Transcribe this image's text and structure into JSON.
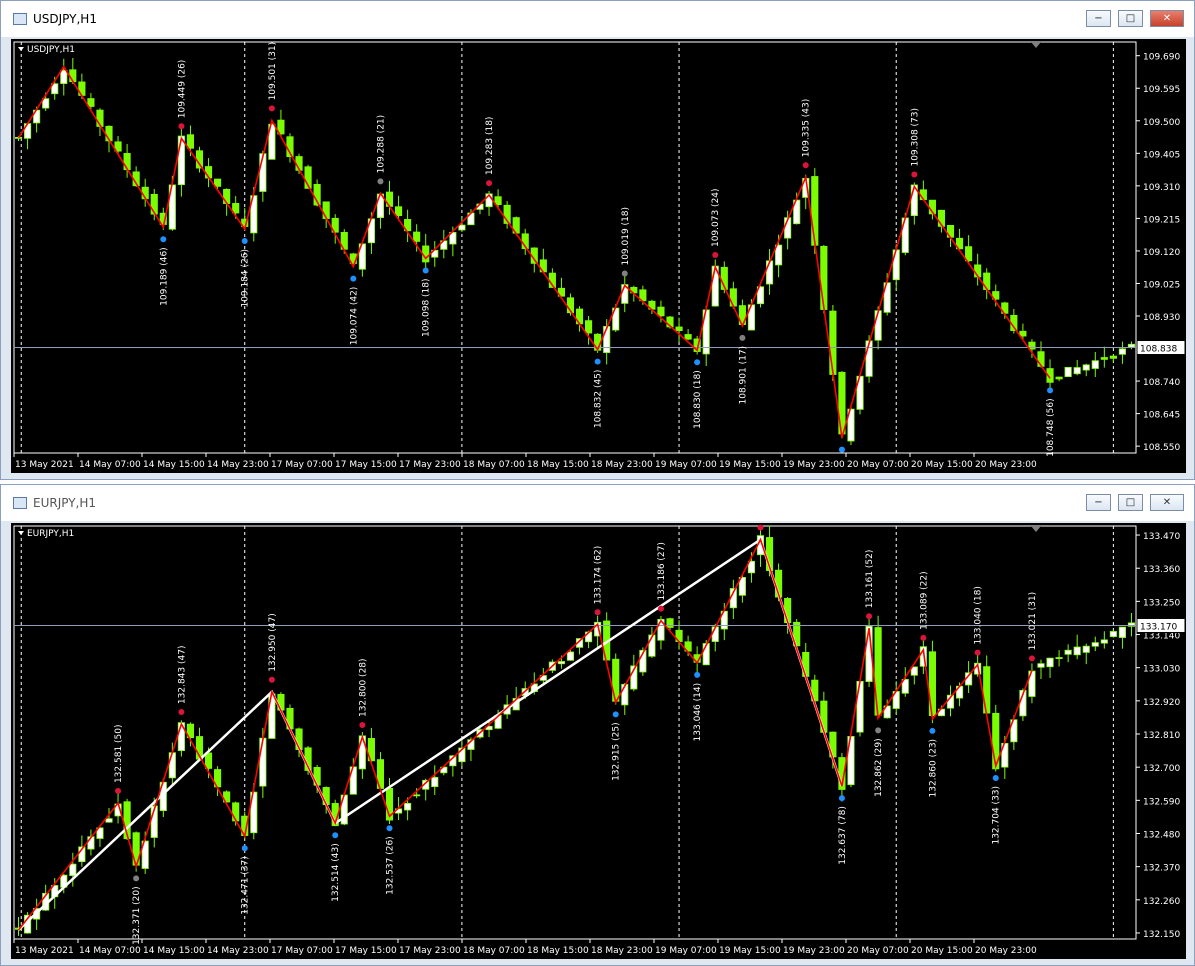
{
  "windows": [
    {
      "title": "USDJPY,H1",
      "active": true,
      "chart_label": "USDJPY,H1",
      "current_price": "108.838",
      "controls": {
        "minimize": "−",
        "maximize": "□",
        "close": "✕"
      }
    },
    {
      "title": "EURJPY,H1",
      "active": false,
      "chart_label": "EURJPY,H1",
      "current_price": "133.170",
      "controls": {
        "minimize": "−",
        "maximize": "□",
        "close": "✕"
      }
    }
  ],
  "chart_data": [
    {
      "type": "candlestick",
      "symbol": "USDJPY",
      "timeframe": "H1",
      "y_ticks": [
        "109.690",
        "109.595",
        "109.500",
        "109.405",
        "109.310",
        "109.215",
        "109.120",
        "109.025",
        "108.930",
        "108.835",
        "108.740",
        "108.645",
        "108.550"
      ],
      "ylim": [
        108.53,
        109.73
      ],
      "x_labels": [
        "13 May 2021",
        "14 May 07:00",
        "14 May 15:00",
        "14 May 23:00",
        "17 May 07:00",
        "17 May 15:00",
        "17 May 23:00",
        "18 May 07:00",
        "18 May 15:00",
        "18 May 23:00",
        "19 May 07:00",
        "19 May 15:00",
        "19 May 23:00",
        "20 May 07:00",
        "20 May 15:00",
        "20 May 23:00"
      ],
      "current_price": 108.838,
      "colors": {
        "background": "#000000",
        "candle_up": "#ffffff",
        "candle_down": "#7cfc00",
        "zigzag": "#ff0000",
        "grid": "#ffffff"
      },
      "zigzag": [
        {
          "i": 0,
          "price": 109.45,
          "label": ""
        },
        {
          "i": 5,
          "price": 109.658,
          "label": ""
        },
        {
          "i": 16,
          "price": 109.189,
          "label": "109.189 (46)",
          "side": "low",
          "dot": "#1e90ff"
        },
        {
          "i": 18,
          "price": 109.449,
          "label": "109.449 (26)",
          "side": "high",
          "dot": "#dc143c"
        },
        {
          "i": 25,
          "price": 109.184,
          "label": "109.184 (26)",
          "side": "low",
          "dot": "#1e90ff"
        },
        {
          "i": 28,
          "price": 109.501,
          "label": "109.501 (31)",
          "side": "high",
          "dot": "#dc143c"
        },
        {
          "i": 37,
          "price": 109.074,
          "label": "109.074 (42)",
          "side": "low",
          "dot": "#1e90ff"
        },
        {
          "i": 40,
          "price": 109.288,
          "label": "109.288 (21)",
          "side": "high",
          "dot": "#808080"
        },
        {
          "i": 45,
          "price": 109.098,
          "label": "109.098 (18)",
          "side": "low",
          "dot": "#1e90ff"
        },
        {
          "i": 52,
          "price": 109.283,
          "label": "109.283 (18)",
          "side": "high",
          "dot": "#dc143c"
        },
        {
          "i": 64,
          "price": 108.832,
          "label": "108.832 (45)",
          "side": "low",
          "dot": "#1e90ff"
        },
        {
          "i": 67,
          "price": 109.019,
          "label": "109.019 (18)",
          "side": "high",
          "dot": "#808080"
        },
        {
          "i": 75,
          "price": 108.83,
          "label": "108.830 (18)",
          "side": "low",
          "dot": "#1e90ff"
        },
        {
          "i": 77,
          "price": 109.073,
          "label": "109.073 (24)",
          "side": "high",
          "dot": "#dc143c"
        },
        {
          "i": 80,
          "price": 108.901,
          "label": "108.901 (17)",
          "side": "low",
          "dot": "#808080"
        },
        {
          "i": 87,
          "price": 109.335,
          "label": "109.335 (43)",
          "side": "high",
          "dot": "#dc143c"
        },
        {
          "i": 91,
          "price": 108.575,
          "label": "",
          "side": "low",
          "dot": "#1e90ff"
        },
        {
          "i": 99,
          "price": 109.308,
          "label": "109.308 (73)",
          "side": "high",
          "dot": "#dc143c"
        },
        {
          "i": 114,
          "price": 108.748,
          "label": "108.748 (56)",
          "side": "low",
          "dot": "#1e90ff"
        }
      ],
      "bars": 124
    },
    {
      "type": "candlestick",
      "symbol": "EURJPY",
      "timeframe": "H1",
      "y_ticks": [
        "133.470",
        "133.360",
        "133.250",
        "133.140",
        "133.030",
        "132.920",
        "132.810",
        "132.700",
        "132.590",
        "132.480",
        "132.370",
        "132.260",
        "132.150"
      ],
      "ylim": [
        132.13,
        133.5
      ],
      "x_labels": [
        "13 May 2021",
        "14 May 07:00",
        "14 May 15:00",
        "14 May 23:00",
        "17 May 07:00",
        "17 May 15:00",
        "17 May 23:00",
        "18 May 07:00",
        "18 May 15:00",
        "18 May 23:00",
        "19 May 07:00",
        "19 May 15:00",
        "19 May 23:00",
        "20 May 07:00",
        "20 May 15:00",
        "20 May 23:00"
      ],
      "current_price": 133.17,
      "colors": {
        "background": "#000000",
        "candle_up": "#ffffff",
        "candle_down": "#7cfc00",
        "zigzag": "#ff0000",
        "zigzag_major": "#ffffff",
        "grid": "#ffffff"
      },
      "zigzag": [
        {
          "i": 0,
          "price": 132.16,
          "label": ""
        },
        {
          "i": 11,
          "price": 132.581,
          "label": "132.581 (50)",
          "side": "high",
          "dot": "#dc143c"
        },
        {
          "i": 13,
          "price": 132.371,
          "label": "132.371 (20)",
          "side": "low",
          "dot": "#808080"
        },
        {
          "i": 18,
          "price": 132.843,
          "label": "132.843 (47)",
          "side": "high",
          "dot": "#dc143c"
        },
        {
          "i": 25,
          "price": 132.471,
          "label": "132.471 (37)",
          "side": "low",
          "dot": "#1e90ff"
        },
        {
          "i": 28,
          "price": 132.95,
          "label": "132.950 (47)",
          "side": "high",
          "dot": "#dc143c"
        },
        {
          "i": 35,
          "price": 132.514,
          "label": "132.514 (43)",
          "side": "low",
          "dot": "#1e90ff"
        },
        {
          "i": 38,
          "price": 132.8,
          "label": "132.800 (28)",
          "side": "high",
          "dot": "#dc143c"
        },
        {
          "i": 41,
          "price": 132.537,
          "label": "132.537 (26)",
          "side": "low",
          "dot": "#1e90ff"
        },
        {
          "i": 64,
          "price": 133.174,
          "label": "133.174 (62)",
          "side": "high",
          "dot": "#dc143c"
        },
        {
          "i": 66,
          "price": 132.915,
          "label": "132.915 (25)",
          "side": "low",
          "dot": "#1e90ff"
        },
        {
          "i": 71,
          "price": 133.186,
          "label": "133.186 (27)",
          "side": "high",
          "dot": "#dc143c"
        },
        {
          "i": 75,
          "price": 133.046,
          "label": "133.046 (14)",
          "side": "low",
          "dot": "#1e90ff"
        },
        {
          "i": 82,
          "price": 133.455,
          "label": "",
          "side": "high",
          "dot": "#dc143c"
        },
        {
          "i": 91,
          "price": 132.637,
          "label": "132.637 (78)",
          "side": "low",
          "dot": "#1e90ff"
        },
        {
          "i": 94,
          "price": 133.161,
          "label": "133.161 (52)",
          "side": "high",
          "dot": "#dc143c"
        },
        {
          "i": 95,
          "price": 132.862,
          "label": "132.862 (29)",
          "side": "low",
          "dot": "#808080"
        },
        {
          "i": 100,
          "price": 133.089,
          "label": "133.089 (22)",
          "side": "high",
          "dot": "#dc143c"
        },
        {
          "i": 101,
          "price": 132.86,
          "label": "132.860 (23)",
          "side": "low",
          "dot": "#1e90ff"
        },
        {
          "i": 106,
          "price": 133.04,
          "label": "133.040 (18)",
          "side": "high",
          "dot": "#dc143c"
        },
        {
          "i": 108,
          "price": 132.704,
          "label": "132.704 (33)",
          "side": "low",
          "dot": "#1e90ff"
        },
        {
          "i": 112,
          "price": 133.021,
          "label": "133.021 (31)",
          "side": "high",
          "dot": "#dc143c"
        }
      ],
      "zigzag_major": [
        {
          "i": 0,
          "price": 132.16
        },
        {
          "i": 28,
          "price": 132.95
        },
        {
          "i": 35,
          "price": 132.514
        },
        {
          "i": 82,
          "price": 133.455
        },
        {
          "i": 91,
          "price": 132.637
        }
      ],
      "bars": 124
    }
  ]
}
